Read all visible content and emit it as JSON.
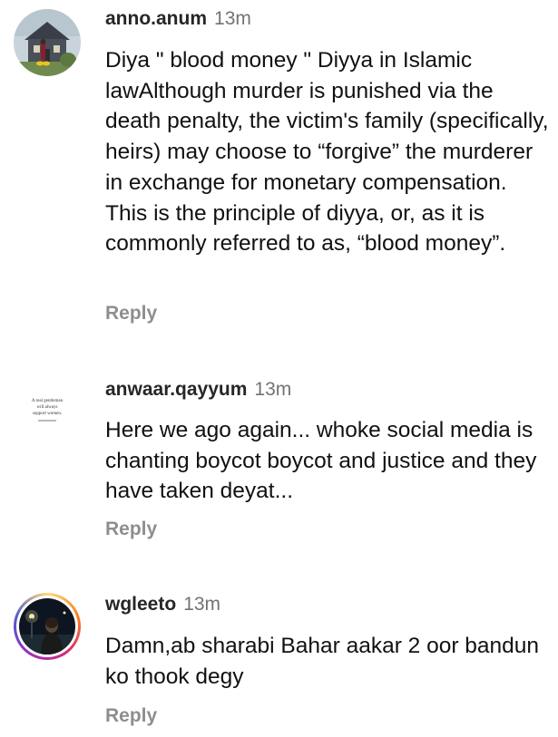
{
  "comments": [
    {
      "username": "anno.anum",
      "time": "13m",
      "text": "Diya \" blood money \" Diyya in Islamic lawAlthough murder is punished via the death penalty, the victim's family (specifically, heirs) may choose to “forgive” the murderer in exchange for monetary compensation. This is the principle of diyya, or, as it is commonly referred to as, “blood money”.",
      "reply_label": "Reply",
      "avatar_icon": "house-photo-avatar"
    },
    {
      "username": "anwaar.qayyum",
      "time": "13m",
      "text": "Here we ago again... whoke social media is chanting boycot boycot and justice and they have taken deyat...",
      "reply_label": "Reply",
      "avatar_icon": "quote-text-avatar",
      "avatar_text": {
        "line1": "A real gentleman",
        "line2": "will always",
        "line3": "support women."
      }
    },
    {
      "username": "wgleeto",
      "time": "13m",
      "text": "Damn,ab sharabi Bahar aakar 2 oor bandun ko thook degy",
      "reply_label": "Reply",
      "avatar_icon": "night-photo-avatar"
    }
  ]
}
